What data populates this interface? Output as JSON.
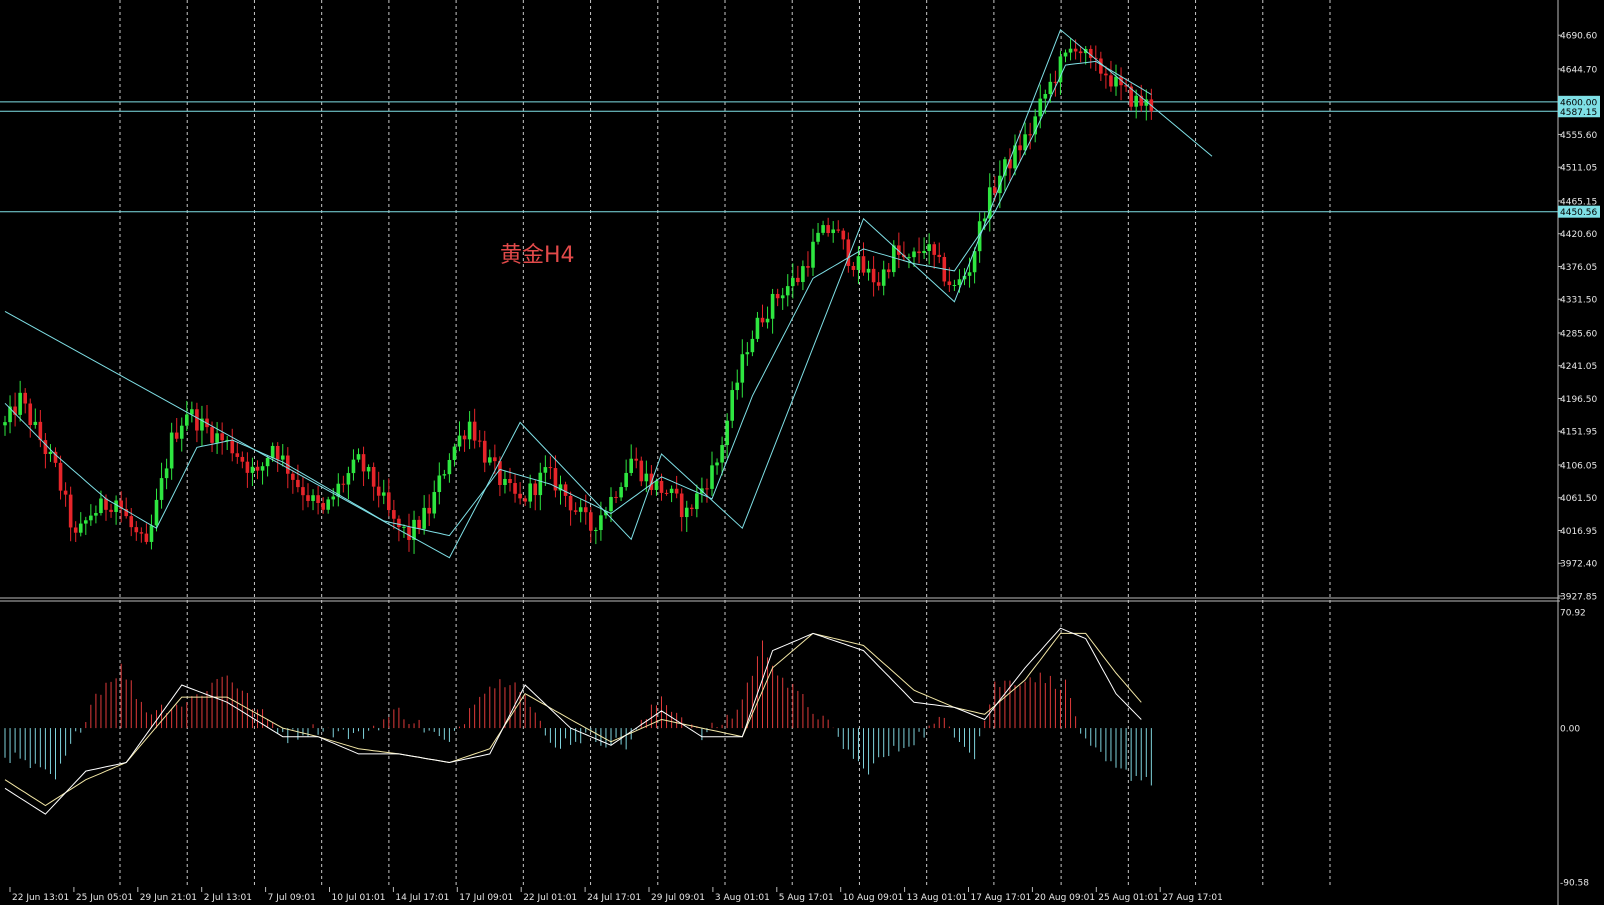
{
  "chart_data": [
    {
      "type": "candlestick",
      "annotation": "黄金H4",
      "ylim": [
        3927.85,
        4714
      ],
      "price_ticks": [
        "4690.60",
        "4644.70",
        "4600.00",
        "4587.15",
        "4555.60",
        "4511.05",
        "4465.15",
        "4450.56",
        "4420.60",
        "4376.05",
        "4331.50",
        "4285.60",
        "4241.05",
        "4196.50",
        "4151.95",
        "4106.05",
        "4061.50",
        "4016.95",
        "3972.40",
        "3927.85"
      ],
      "horizontal_lines": [
        {
          "label": "4600.00",
          "value": 4600.0
        },
        {
          "label": "4587.15",
          "value": 4587.15
        },
        {
          "label": "4450.56",
          "value": 4450.56
        }
      ],
      "x_dates": [
        "22 Jun 13:01",
        "25 Jun 05:01",
        "29 Jun 21:01",
        "2 Jul 13:01",
        "7 Jul 09:01",
        "10 Jul 01:01",
        "14 Jul 17:01",
        "17 Jul 09:01",
        "22 Jul 01:01",
        "24 Jul 17:01",
        "29 Jul 09:01",
        "3 Aug 01:01",
        "5 Aug 17:01",
        "10 Aug 09:01",
        "13 Aug 01:01",
        "17 Aug 17:01",
        "20 Aug 09:01",
        "25 Aug 01:01",
        "27 Aug 17:01"
      ],
      "anchors": [
        [
          0,
          4160
        ],
        [
          3,
          4195
        ],
        [
          10,
          4100
        ],
        [
          14,
          4005
        ],
        [
          17,
          4040
        ],
        [
          22,
          4060
        ],
        [
          25,
          4020
        ],
        [
          28,
          3990
        ],
        [
          33,
          4140
        ],
        [
          36,
          4180
        ],
        [
          39,
          4160
        ],
        [
          45,
          4130
        ],
        [
          50,
          4090
        ],
        [
          53,
          4135
        ],
        [
          58,
          4080
        ],
        [
          63,
          4040
        ],
        [
          66,
          4075
        ],
        [
          70,
          4110
        ],
        [
          74,
          4070
        ],
        [
          77,
          4025
        ],
        [
          80,
          4010
        ],
        [
          84,
          4045
        ],
        [
          88,
          4120
        ],
        [
          92,
          4165
        ],
        [
          95,
          4120
        ],
        [
          99,
          4075
        ],
        [
          102,
          4055
        ],
        [
          107,
          4095
        ],
        [
          110,
          4075
        ],
        [
          113,
          4045
        ],
        [
          116,
          4020
        ],
        [
          120,
          4060
        ],
        [
          124,
          4115
        ],
        [
          128,
          4080
        ],
        [
          131,
          4070
        ],
        [
          135,
          4040
        ],
        [
          138,
          4075
        ],
        [
          141,
          4110
        ],
        [
          144,
          4195
        ],
        [
          147,
          4270
        ],
        [
          150,
          4310
        ],
        [
          154,
          4345
        ],
        [
          157,
          4360
        ],
        [
          161,
          4415
        ],
        [
          164,
          4430
        ],
        [
          167,
          4390
        ],
        [
          170,
          4370
        ],
        [
          173,
          4355
        ],
        [
          176,
          4395
        ],
        [
          179,
          4380
        ],
        [
          182,
          4405
        ],
        [
          185,
          4375
        ],
        [
          188,
          4345
        ],
        [
          191,
          4375
        ],
        [
          194,
          4455
        ],
        [
          197,
          4500
        ],
        [
          200,
          4530
        ],
        [
          203,
          4560
        ],
        [
          206,
          4610
        ],
        [
          209,
          4650
        ],
        [
          212,
          4680
        ],
        [
          215,
          4650
        ],
        [
          218,
          4640
        ],
        [
          221,
          4615
        ],
        [
          224,
          4600
        ],
        [
          227,
          4595
        ]
      ],
      "zigzag": [
        [
          0,
          4315
        ],
        [
          88,
          3980
        ],
        [
          102,
          4164
        ],
        [
          124,
          4005
        ],
        [
          130,
          4121
        ],
        [
          146,
          4020
        ],
        [
          170,
          4441
        ],
        [
          188,
          4328
        ],
        [
          209,
          4698
        ],
        [
          239,
          4526
        ]
      ],
      "ma": [
        [
          0,
          4190
        ],
        [
          10,
          4120
        ],
        [
          20,
          4060
        ],
        [
          30,
          4020
        ],
        [
          38,
          4130
        ],
        [
          45,
          4140
        ],
        [
          55,
          4110
        ],
        [
          65,
          4070
        ],
        [
          75,
          4030
        ],
        [
          88,
          4010
        ],
        [
          98,
          4100
        ],
        [
          108,
          4080
        ],
        [
          120,
          4040
        ],
        [
          130,
          4090
        ],
        [
          140,
          4060
        ],
        [
          148,
          4200
        ],
        [
          160,
          4360
        ],
        [
          170,
          4400
        ],
        [
          180,
          4380
        ],
        [
          188,
          4370
        ],
        [
          196,
          4450
        ],
        [
          204,
          4560
        ],
        [
          210,
          4650
        ],
        [
          216,
          4655
        ],
        [
          227,
          4610
        ]
      ]
    },
    {
      "type": "oscillator",
      "ylim": [
        -90.58,
        70.92
      ],
      "y_ticks": [
        "70.92",
        "0.00",
        "-90.58"
      ],
      "histogram_anchors": [
        [
          0,
          -15
        ],
        [
          10,
          -30
        ],
        [
          18,
          20
        ],
        [
          23,
          35
        ],
        [
          28,
          10
        ],
        [
          36,
          15
        ],
        [
          44,
          32
        ],
        [
          50,
          10
        ],
        [
          56,
          -5
        ],
        [
          62,
          0
        ],
        [
          70,
          -5
        ],
        [
          78,
          10
        ],
        [
          88,
          -10
        ],
        [
          94,
          22
        ],
        [
          101,
          30
        ],
        [
          108,
          -10
        ],
        [
          115,
          -5
        ],
        [
          123,
          -10
        ],
        [
          130,
          18
        ],
        [
          138,
          -5
        ],
        [
          145,
          10
        ],
        [
          150,
          48
        ],
        [
          155,
          25
        ],
        [
          162,
          5
        ],
        [
          170,
          -25
        ],
        [
          178,
          -10
        ],
        [
          186,
          5
        ],
        [
          192,
          -15
        ],
        [
          196,
          25
        ],
        [
          204,
          30
        ],
        [
          210,
          25
        ],
        [
          214,
          -10
        ],
        [
          220,
          -25
        ],
        [
          227,
          -30
        ]
      ],
      "line_anchors": [
        [
          0,
          -35
        ],
        [
          8,
          -50
        ],
        [
          16,
          -25
        ],
        [
          24,
          -20
        ],
        [
          35,
          25
        ],
        [
          44,
          15
        ],
        [
          55,
          -5
        ],
        [
          62,
          -5
        ],
        [
          70,
          -15
        ],
        [
          78,
          -15
        ],
        [
          88,
          -20
        ],
        [
          96,
          -15
        ],
        [
          103,
          25
        ],
        [
          112,
          0
        ],
        [
          120,
          -10
        ],
        [
          130,
          10
        ],
        [
          138,
          -5
        ],
        [
          146,
          -5
        ],
        [
          152,
          45
        ],
        [
          160,
          55
        ],
        [
          170,
          45
        ],
        [
          180,
          15
        ],
        [
          188,
          12
        ],
        [
          194,
          5
        ],
        [
          202,
          35
        ],
        [
          209,
          58
        ],
        [
          214,
          52
        ],
        [
          220,
          20
        ],
        [
          225,
          5
        ]
      ],
      "signal_anchors": [
        [
          0,
          -30
        ],
        [
          8,
          -45
        ],
        [
          16,
          -30
        ],
        [
          24,
          -20
        ],
        [
          35,
          18
        ],
        [
          44,
          18
        ],
        [
          55,
          0
        ],
        [
          62,
          -5
        ],
        [
          70,
          -12
        ],
        [
          78,
          -15
        ],
        [
          88,
          -20
        ],
        [
          96,
          -12
        ],
        [
          103,
          20
        ],
        [
          112,
          5
        ],
        [
          120,
          -8
        ],
        [
          130,
          5
        ],
        [
          138,
          0
        ],
        [
          146,
          -5
        ],
        [
          152,
          35
        ],
        [
          160,
          55
        ],
        [
          170,
          48
        ],
        [
          180,
          22
        ],
        [
          188,
          12
        ],
        [
          194,
          8
        ],
        [
          202,
          28
        ],
        [
          209,
          55
        ],
        [
          214,
          55
        ],
        [
          220,
          32
        ],
        [
          225,
          15
        ]
      ]
    }
  ],
  "colors": {
    "background": "#000000",
    "grid": "#c8c8c8",
    "bull": "#2ee640",
    "bear": "#e6252a",
    "line": "#7fe0e6",
    "axis_text": "#e6e6e6",
    "annotation": "#e24a4a",
    "hist_pos": "#e03a3a",
    "hist_neg": "#7fd3dc",
    "osc_main": "#ffffff",
    "osc_signal": "#f3e7a6"
  }
}
